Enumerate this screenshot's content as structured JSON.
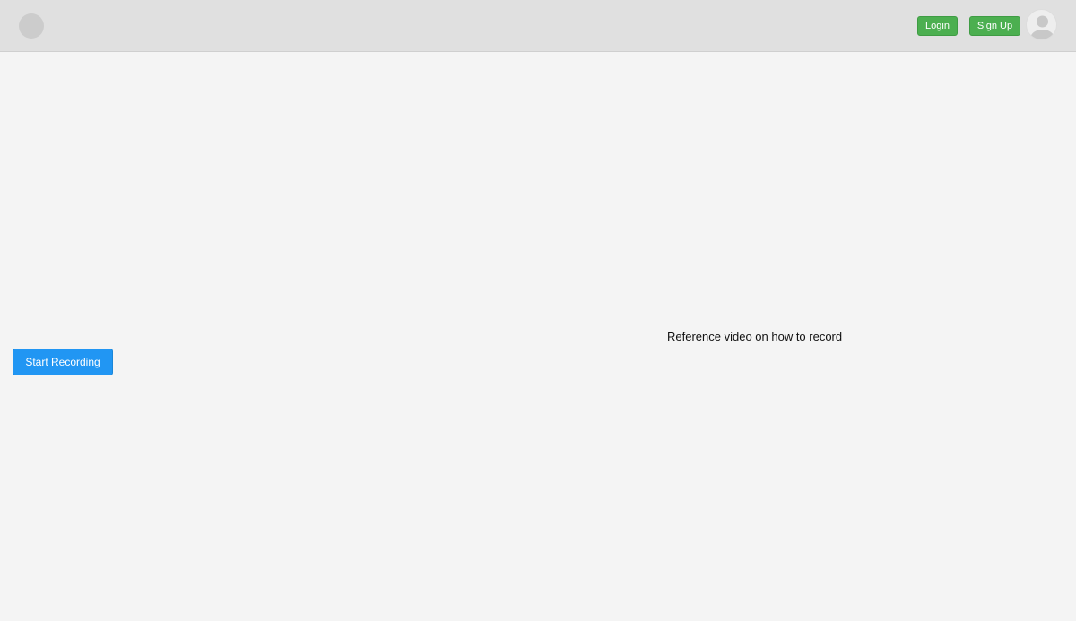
{
  "header": {
    "login_label": "Login",
    "signup_label": "Sign Up",
    "logo_icon": "circle-logo-icon",
    "avatar_icon": "user-avatar-icon"
  },
  "main": {
    "reference_text": "Reference video on how to record",
    "start_recording_label": "Start Recording"
  },
  "colors": {
    "header_bg": "#e0e0e0",
    "page_bg": "#f4f4f4",
    "green_button": "#4caf50",
    "blue_button": "#2196f3"
  }
}
